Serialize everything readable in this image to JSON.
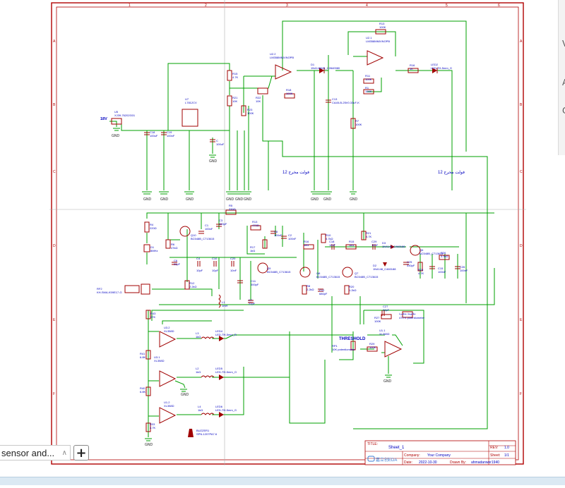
{
  "sheet_frame": {
    "col_markers": [
      "1",
      "2",
      "3",
      "4",
      "5",
      "6"
    ],
    "row_markers": [
      "A",
      "B",
      "C",
      "D",
      "E",
      "F"
    ]
  },
  "title_block": {
    "title_label": "TITLE:",
    "title_value": "Sheet_1",
    "rev_label": "REV:",
    "rev_value": "1.0",
    "company_label": "Company:",
    "company_value": "Your Company",
    "sheet_label": "Sheet:",
    "sheet_value": "1/1",
    "date_label": "Date:",
    "date_value": "2022-10-30",
    "drawn_label": "Drawn By:",
    "drawn_value": "ahmadanwer1940",
    "logo_text": "嘉立创EDA"
  },
  "power": {
    "supply_label": "18V",
    "connector": "U5",
    "connector_part": "XJ39-76202G01",
    "regulator": "U7",
    "regulator_part": "L7812CV",
    "c18": "C18",
    "c18_val": "100uF",
    "c19": "C19",
    "c19_val": "100nF",
    "c_b": "C",
    "c_b_val": "100uF"
  },
  "top_block": {
    "u2_2": "U2.2",
    "u2_2_part": "LM358MMX/NOPB",
    "u2_1": "U2.1",
    "u2_1_part": "LM358MMX/NOPB",
    "r13": "R13",
    "r13_val": "100K",
    "r18": "R18",
    "r18_val": "100K",
    "d1": "D1",
    "d1_part": "1N4148WS_C2840980",
    "r15": "R15",
    "r15_val": "4.7K",
    "r22": "R22",
    "r22_val": "10K",
    "r21": "R21",
    "r21_val": "10K",
    "r23": "R23",
    "r23_val": "100K",
    "r16": "R16",
    "r16_val": "1K",
    "led2": "LED2",
    "led2_part": "LED-TH-5mm_G",
    "c13": "C13",
    "c13_part": "CA45-B-25V0.33uF-K",
    "r11": "R11",
    "r11_val": "100K",
    "r1": "R1",
    "r1_val": "100K",
    "r7": "R7",
    "r7_val": "100K",
    "arabic_note_1": "فولت مخرج 12",
    "arabic_note_2": "فولت مخرج 12"
  },
  "rf_block": {
    "r5": "R5",
    "r5_val": "330Ω",
    "r4": "R4",
    "r4_val": "220Ω",
    "c1": "C1",
    "c1_val": "100nF",
    "r6": "R6",
    "r6_val": "47kΩ",
    "d11": "D1",
    "d11_val": "8MHz",
    "q10": "Q10",
    "q10_part": "BC548B_C713615",
    "c6": "C6",
    "c6_val": "22pF",
    "c4": "C4",
    "c4_val": "10pF",
    "c10": "C10",
    "c10_val": "10pF",
    "r13b": "R13",
    "r13b_val": "470Ω",
    "r17": "R17",
    "r17_val": "1kΩ",
    "r12": "R12",
    "r12_val": "2.2kΩ",
    "c11": "C11",
    "c11_val": "300pF",
    "c7": "C7",
    "c7_val": "22pF",
    "l1": "L1",
    "l1_val": "1mH",
    "q9": "Q9",
    "q9_part": "BC548B_C713615",
    "q8": "Q8",
    "q8_part": "BC548B_C713615",
    "q7": "Q7",
    "q7_part": "BC548B_C713615",
    "q6": "Q6",
    "q6_part": "BC548B_C713615",
    "r8": "R8",
    "r8_val": "2.2kΩ",
    "c8": "C8",
    "c8_val": "100nF",
    "c20": "C20",
    "c20_val": "10nF",
    "r10": "R10",
    "r10_val": "4.7kΩ",
    "c12": "C12",
    "c12_val": "680pF",
    "r16b": "R16",
    "r16b_val": "1kΩ",
    "r15b": "R15",
    "r15b_val": "1kΩ",
    "c18b": "C18",
    "c18b_val": "10nF",
    "c29": "C29",
    "c29_val": "10nF",
    "d3": "D3",
    "d3_part": "1N4148_C460188",
    "d2": "D2",
    "d2_part": "1N4148_C460188",
    "c25": "C25",
    "c25_val": "330pF",
    "r24": "R24",
    "r24_val": "4.7K",
    "c15": "C15",
    "c15_val": "100nF",
    "c26": "C26",
    "c26_val": "100nF",
    "r26": "R26",
    "r26_val": "3.3kΩ",
    "r20": "R20",
    "r20_val": "1.2kΩ",
    "c2": "C2",
    "c2_val": "100nF",
    "c3": "C3",
    "c3_val": "100pF",
    "r21b": "R21",
    "r21b_val": "4.7K",
    "rf2": "RF2",
    "rf2_part": "KH-SMA-K59E17-G"
  },
  "threshold_block": {
    "threshold_label": "THRESHOLD",
    "u1_1": "U1.1",
    "u1_1_part": "XL358D",
    "r27": "R27",
    "r27_val": "100K",
    "c27": "C27",
    "c27_val": "22pF",
    "rp1": "RP1",
    "rp1_part": "10K potentiometer",
    "r29": "R29",
    "r29_val": "100K",
    "arabic_pot": "مقاومة متغيرة",
    "pot_part": "470 K potentiometer"
  },
  "led_block": {
    "r43": "R43",
    "r43_val": "47K",
    "u3_2": "U3.2",
    "u3_2_part": "XL358D",
    "r41": "R41",
    "r41_val": "6.8K",
    "u3_1": "U3.1",
    "u3_1_part": "XL358D",
    "r40": "R40",
    "r40_val": "6.8K",
    "u1_2": "U1.2",
    "u1_2_part": "XL358D",
    "r33": "R33",
    "r33_val": "4.7K",
    "l3": "L3",
    "l3_val": "1kΩ",
    "l2": "L2",
    "l2_val": "1kΩ",
    "l4": "L4",
    "l4_val": "1kΩ",
    "led4": "LED4",
    "led4_part": "LED-TH-5mm_R",
    "led5": "LED5",
    "led5_part": "LED-TH-5mm_O",
    "led6": "LED6",
    "led6_part": "LED-TH-5mm_G",
    "buzzer": "BUZZER1",
    "buzzer_part": "SPN-1207PA7.6"
  },
  "gnd_label": "GND",
  "tab": {
    "label": "sensor and...",
    "chevron_icon": "chevron-up-icon",
    "add_label": "+"
  },
  "right_panel": {
    "glyph_1": "V",
    "glyph_2": "A",
    "glyph_3": "C"
  },
  "colors": {
    "wire": "#00a000",
    "border": "#b00000",
    "component": "#a00000",
    "label": "#0000c0",
    "paper": "#ffffff"
  }
}
